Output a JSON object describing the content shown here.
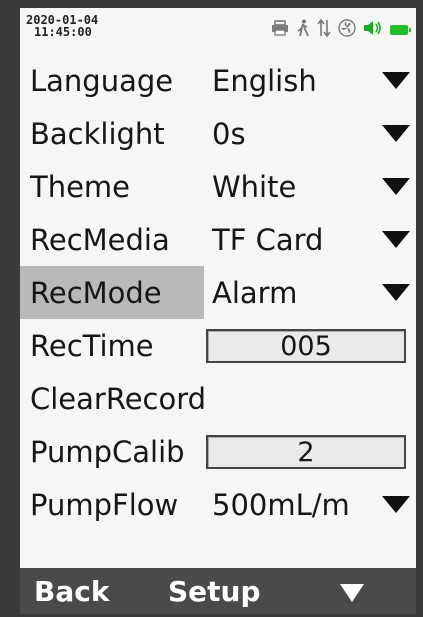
{
  "status_bar": {
    "date": "2020-01-04",
    "time": "11:45:00",
    "icons": [
      "printer-icon",
      "walking-person-icon",
      "transfer-arrows-icon",
      "fan-icon",
      "speaker-icon",
      "battery-icon"
    ]
  },
  "menu": [
    {
      "label": "Language",
      "value": "English",
      "control": "dropdown"
    },
    {
      "label": "Backlight",
      "value": "0s",
      "control": "dropdown"
    },
    {
      "label": "Theme",
      "value": "White",
      "control": "dropdown"
    },
    {
      "label": "RecMedia",
      "value": "TF Card",
      "control": "dropdown"
    },
    {
      "label": "RecMode",
      "value": "Alarm",
      "control": "dropdown",
      "selected": true
    },
    {
      "label": "RecTime",
      "value": "005",
      "control": "spinbox"
    },
    {
      "label": "ClearRecord",
      "value": "",
      "control": "action"
    },
    {
      "label": "PumpCalib",
      "value": "2",
      "control": "spinbox"
    },
    {
      "label": "PumpFlow",
      "value": "500mL/m",
      "control": "dropdown"
    }
  ],
  "softkeys": {
    "left": "Back",
    "center": "Setup",
    "right_icon": "down-triangle-icon"
  },
  "colors": {
    "screen_bg": "#f6f6f4",
    "selected_row": "#b9b9b9",
    "softkey_bar": "#4a4a4a",
    "battery": "#1fbf2a",
    "speaker": "#1fa826"
  }
}
